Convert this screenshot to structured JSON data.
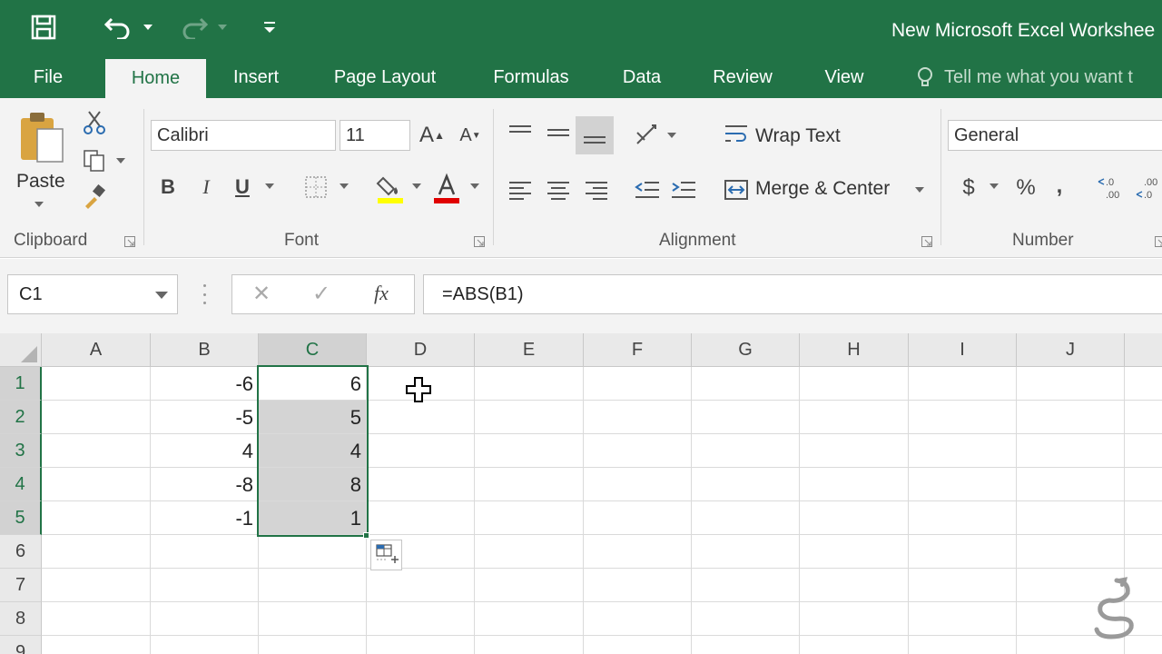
{
  "app": {
    "title": "New Microsoft Excel Workshee",
    "accent_color": "#217346"
  },
  "quick_access": {
    "icons": [
      "save-icon",
      "undo-icon",
      "redo-icon",
      "customize-icon"
    ]
  },
  "tabs": [
    {
      "label": "File"
    },
    {
      "label": "Home"
    },
    {
      "label": "Insert"
    },
    {
      "label": "Page Layout"
    },
    {
      "label": "Formulas"
    },
    {
      "label": "Data"
    },
    {
      "label": "Review"
    },
    {
      "label": "View"
    }
  ],
  "active_tab": "Home",
  "tell_me": {
    "placeholder": "Tell me what you want t"
  },
  "ribbon": {
    "clipboard": {
      "paste_label": "Paste",
      "group_label": "Clipboard"
    },
    "font": {
      "font_name": "Calibri",
      "font_size": "11",
      "group_label": "Font",
      "bold": "B",
      "italic": "I",
      "underline": "U",
      "highlight_color": "#ffff00",
      "font_color": "#e00000"
    },
    "alignment": {
      "wrap_text": "Wrap Text",
      "merge_center": "Merge & Center",
      "group_label": "Alignment"
    },
    "number": {
      "format": "General",
      "currency": "$",
      "percent": "%",
      "comma": ",",
      "group_label": "Number",
      "inc_decimal": ".0\n.00",
      "dec_decimal": ".00\n.0"
    }
  },
  "formula_bar": {
    "name_box": "C1",
    "cancel": "✕",
    "enter": "✓",
    "fx": "fx",
    "formula": "=ABS(B1)"
  },
  "sheet": {
    "columns": [
      "A",
      "B",
      "C",
      "D",
      "E",
      "F",
      "G",
      "H",
      "I",
      "J"
    ],
    "rows": [
      "1",
      "2",
      "3",
      "4",
      "5",
      "6",
      "7",
      "8",
      "9"
    ],
    "selected_column": "C",
    "selected_range": "C1:C5",
    "cells": {
      "B1": "-6",
      "C1": "6",
      "B2": "-5",
      "C2": "5",
      "B3": "4",
      "C3": "4",
      "B4": "-8",
      "C4": "8",
      "B5": "-1",
      "C5": "1"
    }
  }
}
